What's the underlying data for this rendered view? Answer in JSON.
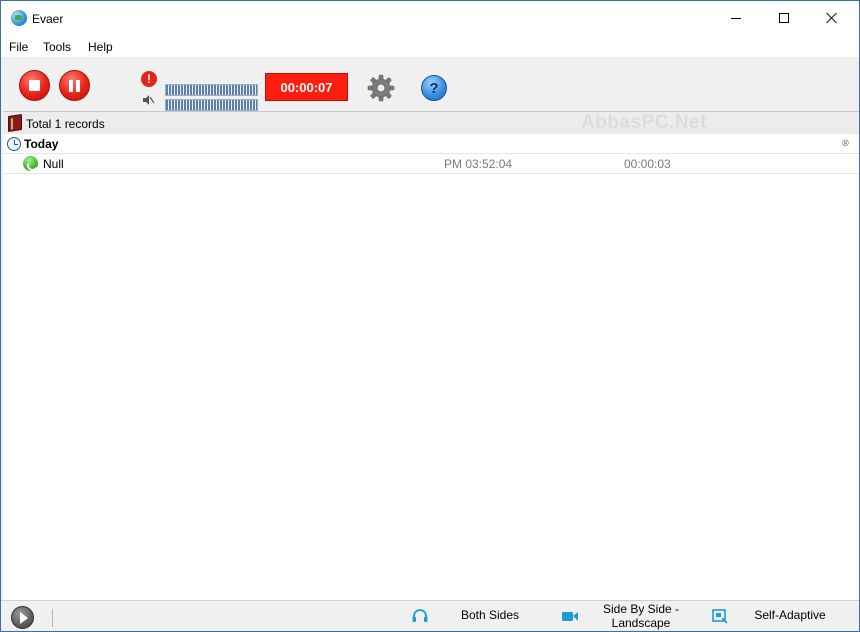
{
  "window": {
    "title": "Evaer"
  },
  "menu": {
    "items": [
      "File",
      "Tools",
      "Help"
    ]
  },
  "toolbar": {
    "timer": "00:00:07",
    "warning_glyph": "!",
    "help_glyph": "?",
    "icons": [
      "stop-icon",
      "pause-icon",
      "warning-icon",
      "speaker-icon",
      "gear-icon",
      "help-icon"
    ]
  },
  "records": {
    "total_label": "Total 1 records",
    "watermark": "AbbasPC.Net",
    "groups": [
      {
        "label": "Today",
        "items": [
          {
            "name": "Null",
            "time": "PM 03:52:04",
            "duration": "00:00:03"
          }
        ]
      }
    ]
  },
  "bottombar": {
    "modes": [
      {
        "label": "Both Sides",
        "icon": "headset-icon"
      },
      {
        "label": "Side By Side - Landscape",
        "icon": "video-camera-icon"
      },
      {
        "label": "Self-Adaptive",
        "icon": "screen-adaptive-icon"
      }
    ]
  },
  "colors": {
    "record_red": "#e8231b",
    "timer_bg": "#ff1d10",
    "accent_blue": "#1e9ad6",
    "call_green": "#3fb52a"
  }
}
